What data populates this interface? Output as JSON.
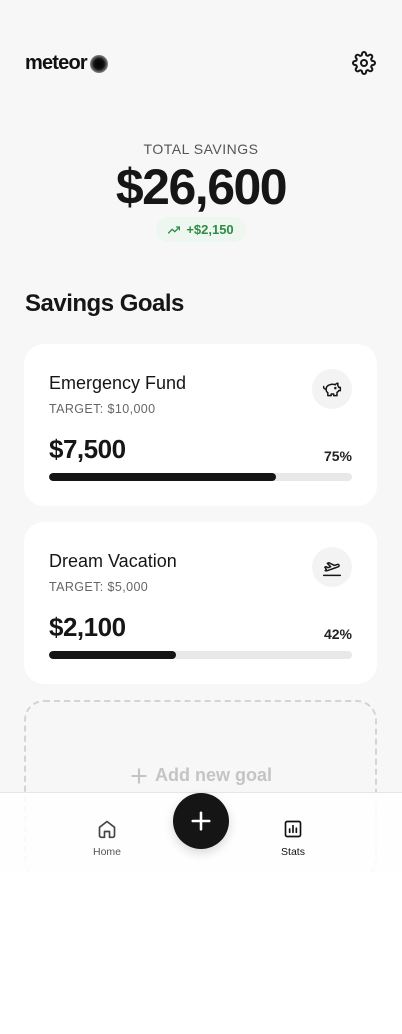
{
  "header": {
    "logo_text": "meteor",
    "settings_icon": "gear-icon"
  },
  "summary": {
    "label": "TOTAL SAVINGS",
    "amount": "$26,600",
    "change": "+$2,150",
    "change_icon": "trending-up-icon",
    "change_color": "#2e8b45"
  },
  "section": {
    "title": "Savings Goals"
  },
  "goals": [
    {
      "name": "Emergency Fund",
      "target": "TARGET: $10,000",
      "amount": "$7,500",
      "percent_label": "75%",
      "progress": 0.75,
      "icon": "piggy-bank-icon"
    },
    {
      "name": "Dream Vacation",
      "target": "TARGET: $5,000",
      "amount": "$2,100",
      "percent_label": "42%",
      "progress": 0.42,
      "icon": "plane-icon"
    }
  ],
  "add_goal": {
    "label": "Add new goal",
    "icon": "plus-icon"
  },
  "nav": {
    "home_label": "Home",
    "home_icon": "home-icon",
    "fab_icon": "plus-icon",
    "stats_label": "Stats",
    "stats_icon": "bar-chart-icon"
  },
  "colors": {
    "accent": "#151515",
    "background": "#f7f7f7",
    "card": "#ffffff",
    "positive": "#2e8b45"
  }
}
